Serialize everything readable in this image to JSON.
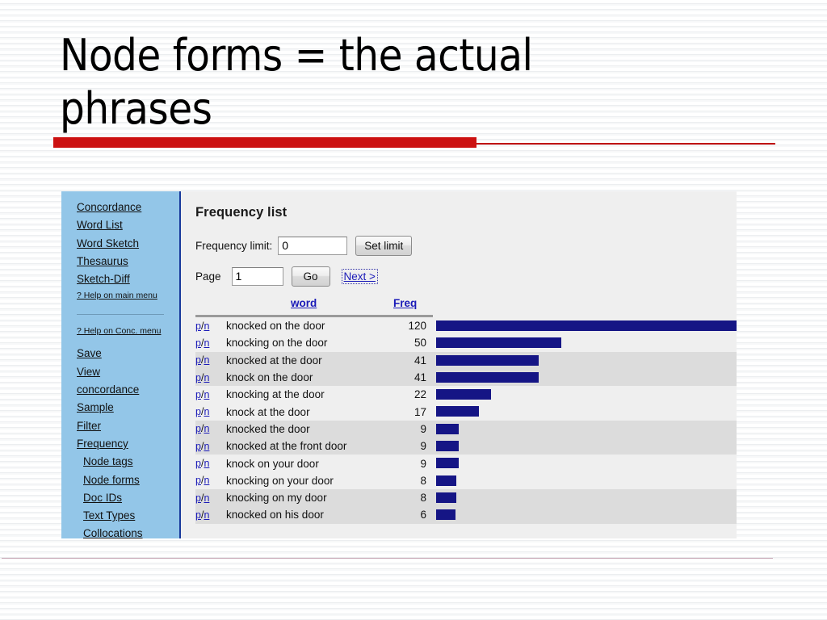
{
  "slide": {
    "title": "Node forms = the actual phrases",
    "accent_color": "#cc1111",
    "rule_color": "#c00000"
  },
  "sidebar": {
    "bg_color": "#93c6e8",
    "border_color": "#18399b",
    "main_items": [
      {
        "label": "Concordance"
      },
      {
        "label": "Word List"
      },
      {
        "label": "Word Sketch"
      },
      {
        "label": "Thesaurus"
      },
      {
        "label": "Sketch-Diff"
      }
    ],
    "main_help": "? Help on main menu",
    "conc_help": "? Help on Conc. menu",
    "conc_items": [
      {
        "label": "Save",
        "indent": false
      },
      {
        "label": "View",
        "indent": false
      },
      {
        "label": "concordance",
        "indent": false
      },
      {
        "label": "Sample",
        "indent": false
      },
      {
        "label": "Filter",
        "indent": false
      },
      {
        "label": "Frequency",
        "indent": false
      },
      {
        "label": "Node tags",
        "indent": true
      },
      {
        "label": "Node forms",
        "indent": true
      },
      {
        "label": "Doc IDs",
        "indent": true
      },
      {
        "label": "Text Types",
        "indent": true
      },
      {
        "label": "Collocations",
        "indent": true
      }
    ]
  },
  "content": {
    "heading": "Frequency list",
    "limit_label": "Frequency limit:",
    "limit_value": "0",
    "limit_placeholder": "0",
    "set_limit_button": "Set limit",
    "page_label": "Page",
    "page_value": "1",
    "page_placeholder": "1",
    "go_button": "Go",
    "next_link": "Next >",
    "link_color": "#1a1ab8"
  },
  "chart_data": {
    "type": "bar",
    "title": "Frequency list",
    "xlabel": "Freq",
    "ylabel": "word",
    "orientation": "horizontal",
    "bar_color": "#151585",
    "columns": [
      "word",
      "Freq"
    ],
    "row_prefix": "p/n",
    "xlim": [
      0,
      120
    ],
    "grid": false,
    "legend": "none",
    "categories": [
      "knocked on the door",
      "knocking on the door",
      "knocked at the door",
      "knock on the door",
      "knocking at the door",
      "knock at the door",
      "knocked the door",
      "knocked at the front door",
      "knock on your door",
      "knocking on your door",
      "knocking on my door",
      "knocked on his door"
    ],
    "values": [
      120,
      50,
      41,
      41,
      22,
      17,
      9,
      9,
      9,
      8,
      8,
      6
    ]
  }
}
